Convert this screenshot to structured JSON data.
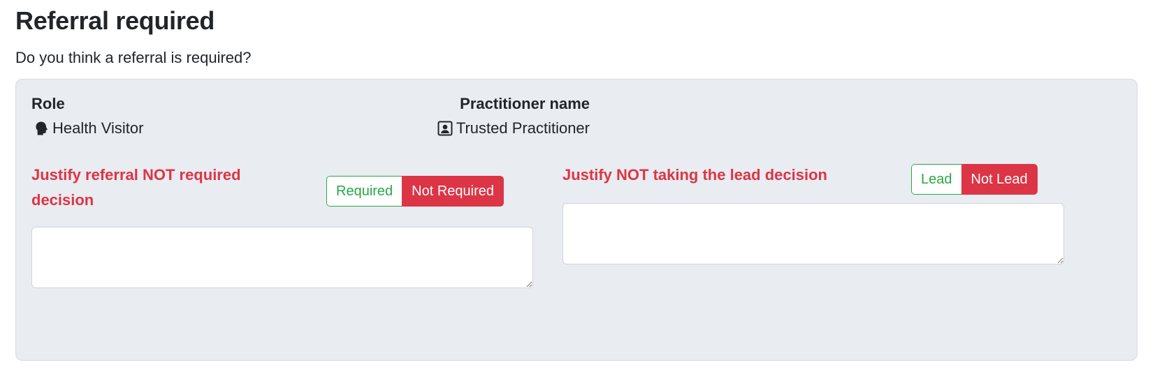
{
  "page": {
    "title": "Referral required",
    "question": "Do you think a referral is required?"
  },
  "card": {
    "role": {
      "label": "Role",
      "icon": "head-profile-icon",
      "value": "Health Visitor"
    },
    "practitioner": {
      "label": "Practitioner name",
      "icon": "contact-card-icon",
      "value": "Trusted Practitioner"
    },
    "referral_decision": {
      "title_line1": "Justify referral NOT required",
      "title_line2": "decision",
      "options": [
        "Required",
        "Not Required"
      ],
      "selected": "Not Required",
      "justification_value": ""
    },
    "lead_decision": {
      "title": "Justify NOT taking the lead decision",
      "options": [
        "Lead",
        "Not Lead"
      ],
      "selected": "Not Lead",
      "justification_value": ""
    }
  },
  "colors": {
    "card_bg": "#e9ecf1",
    "danger": "#dc3545",
    "success": "#28a745"
  }
}
